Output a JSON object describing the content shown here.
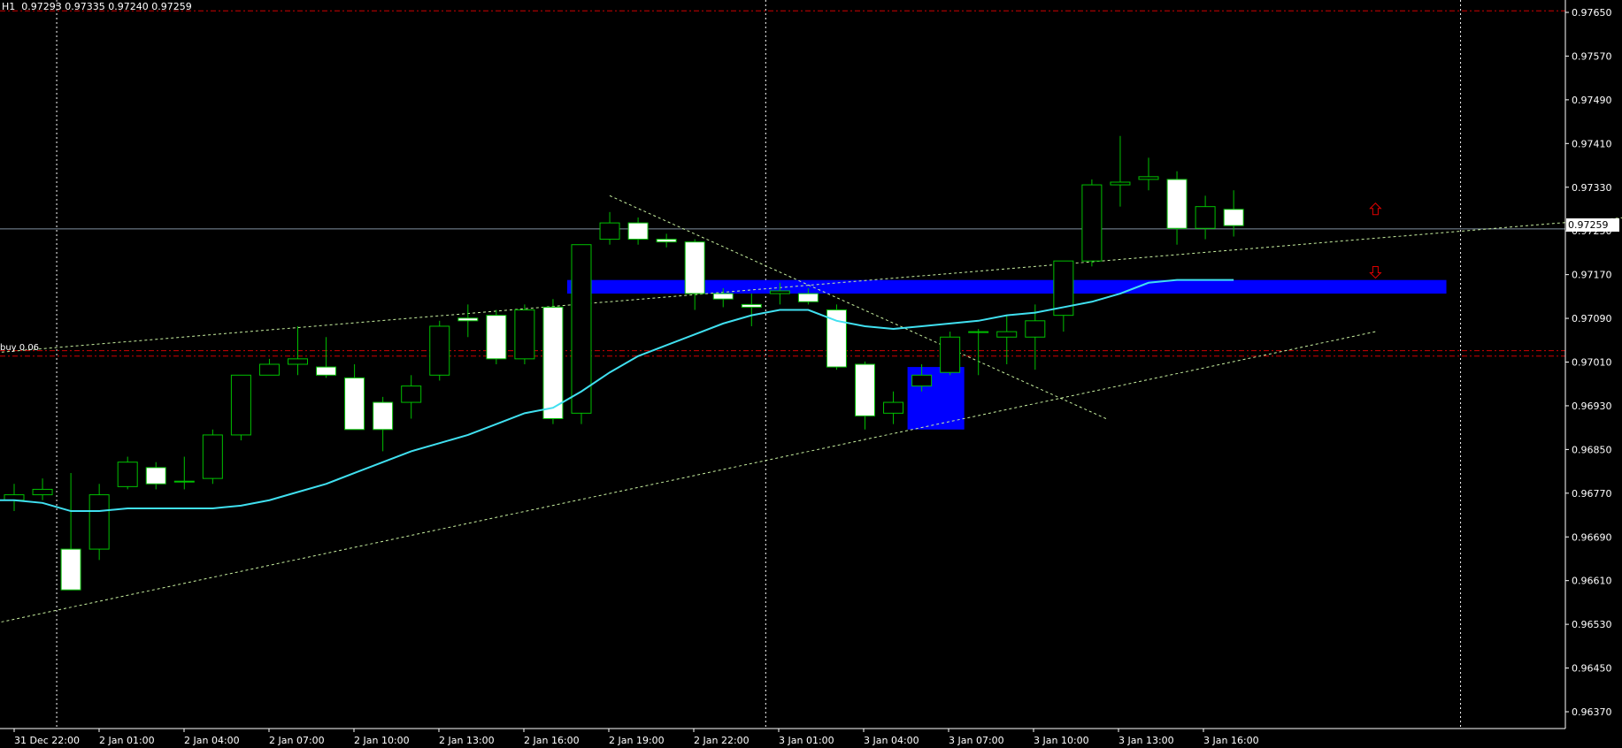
{
  "header": {
    "symbol_period": "H1",
    "ohlc": "0.97293 0.97335 0.97240 0.97259"
  },
  "order_label": "buy 0.06",
  "current_price_label": "0.97259",
  "colors": {
    "background": "#000000",
    "bull_body": "#000000",
    "bear_body": "#ffffff",
    "candle_outline": "#00c000",
    "ma_line": "#40e0f0",
    "zone": "#0000ff",
    "trendline": "#c8f0a0",
    "red_level": "#d00000",
    "grid": "#ffffff",
    "arrow": "#e00000"
  },
  "chart_data": {
    "type": "candlestick",
    "y_ticks": [
      "0.97650",
      "0.97570",
      "0.97490",
      "0.97410",
      "0.97330",
      "0.97250",
      "0.97170",
      "0.97090",
      "0.97010",
      "0.96930",
      "0.96850",
      "0.96770",
      "0.96690",
      "0.96610",
      "0.96530",
      "0.96450",
      "0.96370"
    ],
    "x_ticks": [
      "31 Dec 22:00",
      "2 Jan 01:00",
      "2 Jan 04:00",
      "2 Jan 07:00",
      "2 Jan 10:00",
      "2 Jan 13:00",
      "2 Jan 16:00",
      "2 Jan 19:00",
      "2 Jan 22:00",
      "3 Jan 01:00",
      "3 Jan 04:00",
      "3 Jan 07:00",
      "3 Jan 10:00",
      "3 Jan 13:00",
      "3 Jan 16:00"
    ],
    "ylim": [
      0.9634,
      0.9768
    ],
    "candles": [
      {
        "o": 0.9676,
        "h": 0.9679,
        "l": 0.9674,
        "c": 0.9677
      },
      {
        "o": 0.9677,
        "h": 0.968,
        "l": 0.9676,
        "c": 0.9678
      },
      {
        "o": 0.9667,
        "h": 0.9681,
        "l": 0.966,
        "c": 0.96595
      },
      {
        "o": 0.9667,
        "h": 0.9679,
        "l": 0.9665,
        "c": 0.9677
      },
      {
        "o": 0.96785,
        "h": 0.9684,
        "l": 0.9678,
        "c": 0.9683
      },
      {
        "o": 0.9682,
        "h": 0.9683,
        "l": 0.9678,
        "c": 0.9679
      },
      {
        "o": 0.96795,
        "h": 0.9684,
        "l": 0.9678,
        "c": 0.96795
      },
      {
        "o": 0.968,
        "h": 0.9689,
        "l": 0.9679,
        "c": 0.9688
      },
      {
        "o": 0.9688,
        "h": 0.9698,
        "l": 0.9687,
        "c": 0.9699
      },
      {
        "o": 0.9699,
        "h": 0.9702,
        "l": 0.9699,
        "c": 0.9701
      },
      {
        "o": 0.9701,
        "h": 0.9708,
        "l": 0.9699,
        "c": 0.9702
      },
      {
        "o": 0.97005,
        "h": 0.9706,
        "l": 0.96985,
        "c": 0.9699
      },
      {
        "o": 0.96985,
        "h": 0.9701,
        "l": 0.9689,
        "c": 0.9689
      },
      {
        "o": 0.9694,
        "h": 0.9695,
        "l": 0.9685,
        "c": 0.9689
      },
      {
        "o": 0.9694,
        "h": 0.9699,
        "l": 0.9691,
        "c": 0.9697
      },
      {
        "o": 0.9699,
        "h": 0.9709,
        "l": 0.9698,
        "c": 0.9708
      },
      {
        "o": 0.97095,
        "h": 0.9712,
        "l": 0.9706,
        "c": 0.9709
      },
      {
        "o": 0.971,
        "h": 0.9711,
        "l": 0.9701,
        "c": 0.9702
      },
      {
        "o": 0.9702,
        "h": 0.9712,
        "l": 0.9701,
        "c": 0.9711
      },
      {
        "o": 0.97115,
        "h": 0.9713,
        "l": 0.969,
        "c": 0.9691
      },
      {
        "o": 0.9692,
        "h": 0.9723,
        "l": 0.969,
        "c": 0.9723
      },
      {
        "o": 0.9724,
        "h": 0.9729,
        "l": 0.9723,
        "c": 0.9727
      },
      {
        "o": 0.9727,
        "h": 0.9728,
        "l": 0.9723,
        "c": 0.9724
      },
      {
        "o": 0.9724,
        "h": 0.9725,
        "l": 0.97225,
        "c": 0.97235
      },
      {
        "o": 0.97235,
        "h": 0.9724,
        "l": 0.9711,
        "c": 0.9714
      },
      {
        "o": 0.9714,
        "h": 0.9715,
        "l": 0.97115,
        "c": 0.9713
      },
      {
        "o": 0.9712,
        "h": 0.9714,
        "l": 0.9708,
        "c": 0.97115
      },
      {
        "o": 0.9714,
        "h": 0.9716,
        "l": 0.9712,
        "c": 0.97145
      },
      {
        "o": 0.9714,
        "h": 0.9715,
        "l": 0.9712,
        "c": 0.97125
      },
      {
        "o": 0.9711,
        "h": 0.9712,
        "l": 0.97,
        "c": 0.97005
      },
      {
        "o": 0.9701,
        "h": 0.97015,
        "l": 0.9689,
        "c": 0.96915
      },
      {
        "o": 0.9692,
        "h": 0.9696,
        "l": 0.969,
        "c": 0.9694
      },
      {
        "o": 0.9697,
        "h": 0.9701,
        "l": 0.9696,
        "c": 0.9699
      },
      {
        "o": 0.96995,
        "h": 0.9707,
        "l": 0.9699,
        "c": 0.9706
      },
      {
        "o": 0.9707,
        "h": 0.97075,
        "l": 0.9699,
        "c": 0.9707
      },
      {
        "o": 0.9706,
        "h": 0.971,
        "l": 0.9701,
        "c": 0.9707
      },
      {
        "o": 0.9706,
        "h": 0.9712,
        "l": 0.97,
        "c": 0.9709
      },
      {
        "o": 0.971,
        "h": 0.972,
        "l": 0.9707,
        "c": 0.972
      },
      {
        "o": 0.972,
        "h": 0.9735,
        "l": 0.9719,
        "c": 0.9734
      },
      {
        "o": 0.9734,
        "h": 0.9743,
        "l": 0.973,
        "c": 0.97345
      },
      {
        "o": 0.9735,
        "h": 0.9739,
        "l": 0.9733,
        "c": 0.97355
      },
      {
        "o": 0.9735,
        "h": 0.97365,
        "l": 0.9723,
        "c": 0.9726
      },
      {
        "o": 0.9726,
        "h": 0.9732,
        "l": 0.9724,
        "c": 0.973
      },
      {
        "o": 0.97295,
        "h": 0.9733,
        "l": 0.97245,
        "c": 0.97265
      }
    ],
    "moving_average": [
      0.9676,
      0.96755,
      0.9674,
      0.9674,
      0.96745,
      0.96745,
      0.96745,
      0.96745,
      0.9675,
      0.9676,
      0.96775,
      0.9679,
      0.9681,
      0.9683,
      0.9685,
      0.96865,
      0.9688,
      0.969,
      0.9692,
      0.9693,
      0.9696,
      0.96995,
      0.97025,
      0.97045,
      0.97065,
      0.97085,
      0.971,
      0.9711,
      0.9711,
      0.9709,
      0.9708,
      0.97075,
      0.9708,
      0.97085,
      0.9709,
      0.971,
      0.97105,
      0.97115,
      0.97125,
      0.9714,
      0.9716,
      0.97165,
      0.97165,
      0.97165
    ],
    "current_price": 0.97259,
    "order_price": 0.9703,
    "red_levels": [
      0.9766,
      0.97035,
      0.97025
    ],
    "zones": [
      {
        "from_bar": 19.5,
        "to_bar": 50.5,
        "low": 0.9714,
        "high": 0.97165
      },
      {
        "from_bar": 31.5,
        "to_bar": 33.5,
        "low": 0.9689,
        "high": 0.97005
      }
    ],
    "trendlines": [
      {
        "b1": -1,
        "p1": 0.9703,
        "b2": 58,
        "p2": 0.97285
      },
      {
        "b1": -1,
        "p1": 0.9653,
        "b2": 48,
        "p2": 0.9707
      },
      {
        "b1": 21,
        "p1": 0.9732,
        "b2": 38.5,
        "p2": 0.9691
      }
    ],
    "arrows": [
      {
        "bar": 48,
        "price": 0.97295,
        "dir": "up"
      },
      {
        "bar": 48,
        "price": 0.9718,
        "dir": "down"
      }
    ],
    "vertical_grid_bars": [
      1.5,
      26.5,
      51
    ]
  }
}
